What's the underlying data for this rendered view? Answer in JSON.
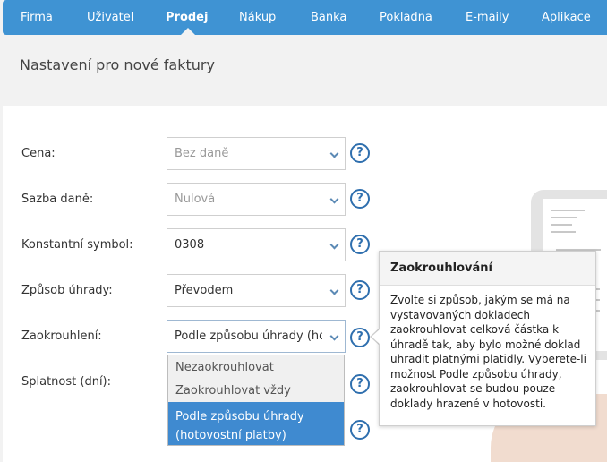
{
  "nav": {
    "items": [
      "Firma",
      "Uživatel",
      "Prodej",
      "Nákup",
      "Banka",
      "Pokladna",
      "E-maily",
      "Aplikace"
    ],
    "active": "Prodej"
  },
  "page_title": "Nastavení pro nové faktury",
  "form": {
    "fields": [
      {
        "label": "Cena:",
        "value": "Bez daně",
        "disabled": true
      },
      {
        "label": "Sazba daně:",
        "value": "Nulová",
        "disabled": true
      },
      {
        "label": "Konstantní symbol:",
        "value": "0308",
        "disabled": false
      },
      {
        "label": "Způsob úhrady:",
        "value": "Převodem",
        "disabled": false
      },
      {
        "label": "Zaokrouhlení:",
        "value": "Podle způsobu úhrady (hotovostní platby)",
        "disabled": false
      },
      {
        "label": "Splatnost (dní):",
        "value": "",
        "disabled": false
      }
    ],
    "help_glyph": "?"
  },
  "dropdown": {
    "options": [
      "Nezaokrouhlovat",
      "Zaokrouhlovat vždy",
      "Podle způsobu úhrady",
      "(hotovostní platby)"
    ],
    "selected_index": 2
  },
  "tooltip": {
    "title": "Zaokrouhlování",
    "lines": [
      "Zvolte si způsob, jakým se má na",
      "vystavovaných dokladech",
      "zaokrouhlovat celková částka k",
      "úhradě tak, aby bylo možné doklad",
      "uhradit platnými platidly. Vyberete-li",
      "možnost Podle způsobu úhrady,",
      "zaokrouhlovat se budou pouze",
      "doklady hrazené v hotovosti."
    ]
  },
  "colors": {
    "nav_bg": "#3f93d3",
    "accent": "#2f6fae",
    "selected": "#3f8ad0"
  }
}
